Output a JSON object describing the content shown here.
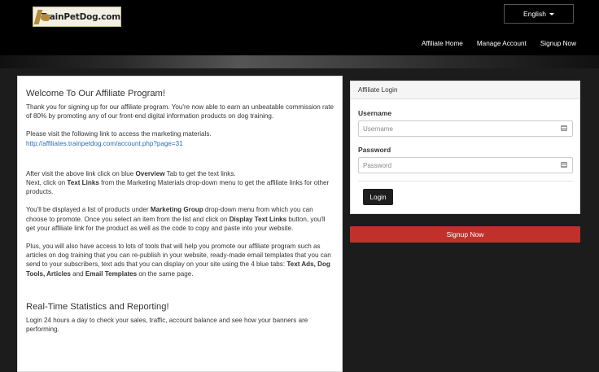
{
  "header": {
    "logo_text": "TrainPetDog.com",
    "language": "English",
    "nav": [
      "Affiliate Home",
      "Manage Account",
      "Signup Now"
    ]
  },
  "intro": {
    "title": "Welcome To Our Affiliate Program!",
    "p1": "Thank you for signing up for our affiliate program. You're now able to earn an unbeatable commission rate of 80% by promoting any of our front-end digital information products on dog training.",
    "p2": "Please visit the following link to access the marketing materials.",
    "link": "http://affiliates.trainpetdog.com/account.php?page=31",
    "p3_a": "After visit the above link click on blue ",
    "p3_b": "Overview",
    "p3_c": " Tab to get the text links.",
    "p3_d": "Next, click on ",
    "p3_e": "Text Links",
    "p3_f": " from the Marketing Materials drop-down menu to get the affiliate links for other products.",
    "p4_a": "You'll be displayed a list of products under ",
    "p4_b": "Marketing Group",
    "p4_c": " drop-down menu from which you can choose to promote. Once you select an item from the list and click on ",
    "p4_d": "Display Text Links",
    "p4_e": " button, you'll get your affiliate link for the product as well as the code to copy and paste into your website.",
    "p5_a": "Plus, you will also have access to lots of tools that will help you promote our affiliate program such as articles on dog training that you can re-publish in your website, ready-made email templates that you can send to your subscribers, text ads that you can display on your site using the 4 blue tabs: ",
    "p5_b": "Text Ads, Dog Tools, Articles",
    "p5_c": " and ",
    "p5_d": "Email Templates",
    "p5_e": " on the same page."
  },
  "stats": {
    "title": "Real-Time Statistics and Reporting!",
    "p1": "Login 24 hours a day to check your sales, traffic, account balance and see how your banners are performing."
  },
  "login": {
    "heading": "Affiliate Login",
    "username_label": "Username",
    "username_placeholder": "Username",
    "password_label": "Password",
    "password_placeholder": "Password",
    "button": "Login"
  },
  "signup_button": "Signup Now",
  "colors": {
    "header_bg": "#000000",
    "signup_red": "#c0312c",
    "link_blue": "#2a6fb5"
  }
}
